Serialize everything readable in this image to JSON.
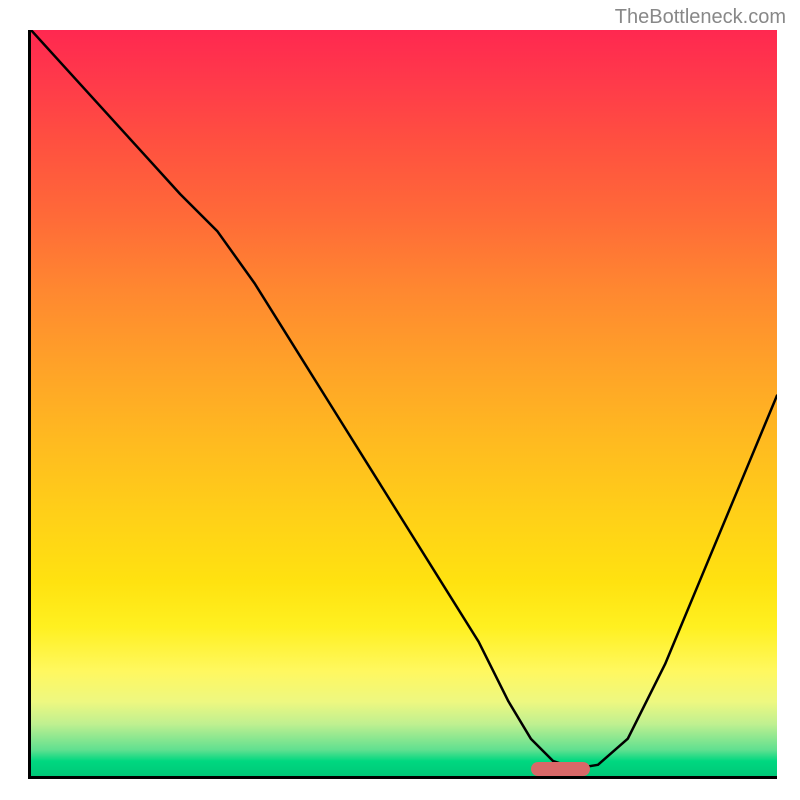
{
  "watermark": "TheBottleneck.com",
  "chart_data": {
    "type": "line",
    "title": "",
    "xlabel": "",
    "ylabel": "",
    "x": [
      0,
      5,
      10,
      15,
      20,
      25,
      30,
      35,
      40,
      45,
      50,
      55,
      60,
      64,
      67,
      70,
      73,
      76,
      80,
      85,
      90,
      95,
      100
    ],
    "values": [
      100,
      94.5,
      89,
      83.5,
      78,
      73,
      66,
      58,
      50,
      42,
      34,
      26,
      18,
      10,
      5,
      2,
      1,
      1.5,
      5,
      15,
      27,
      39,
      51
    ],
    "xlim": [
      0,
      100
    ],
    "ylim": [
      0,
      100
    ],
    "marker": {
      "x": 71,
      "y": 1,
      "width": 8
    }
  }
}
